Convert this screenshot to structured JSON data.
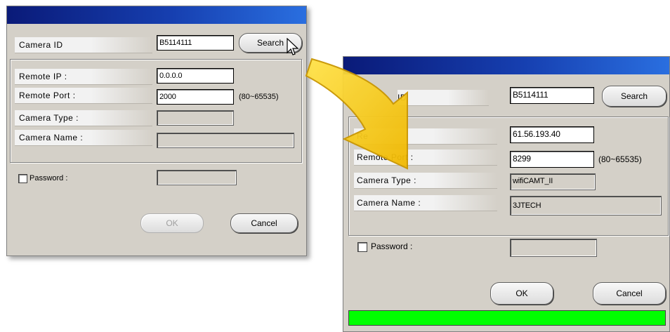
{
  "left_dialog": {
    "camera_id_label": "Camera ID",
    "camera_id_value": "B5114111",
    "search_label": "Search",
    "remote_ip_label": "Remote IP :",
    "remote_ip_value": "0.0.0.0",
    "remote_port_label": "Remote Port :",
    "remote_port_value": "2000",
    "port_range": "(80~65535)",
    "camera_type_label": "Camera Type :",
    "camera_type_value": "",
    "camera_name_label": "Camera Name :",
    "camera_name_value": "",
    "password_label": "Password :",
    "ok_label": "OK",
    "cancel_label": "Cancel"
  },
  "right_dialog": {
    "camera_id_label_partial": "ID",
    "camera_id_value": "B5114111",
    "search_label": "Search",
    "remote_ip_label_partial": "Re",
    "remote_ip_value": "61.56.193.40",
    "remote_port_label": "Remote Port :",
    "remote_port_value": "8299",
    "port_range": "(80~65535)",
    "camera_type_label": "Camera Type :",
    "camera_type_value": "wifiCAMT_II",
    "camera_name_label": "Camera Name :",
    "camera_name_value": "3JTECH",
    "password_label": "Password :",
    "ok_label": "OK",
    "cancel_label": "Cancel",
    "progress_fraction": 1.0
  },
  "colors": {
    "progress": "#00ff00",
    "arrow": "#f5c400"
  },
  "icons": {
    "cursor": "arrow-cursor-icon",
    "transition": "curved-arrow-icon"
  }
}
